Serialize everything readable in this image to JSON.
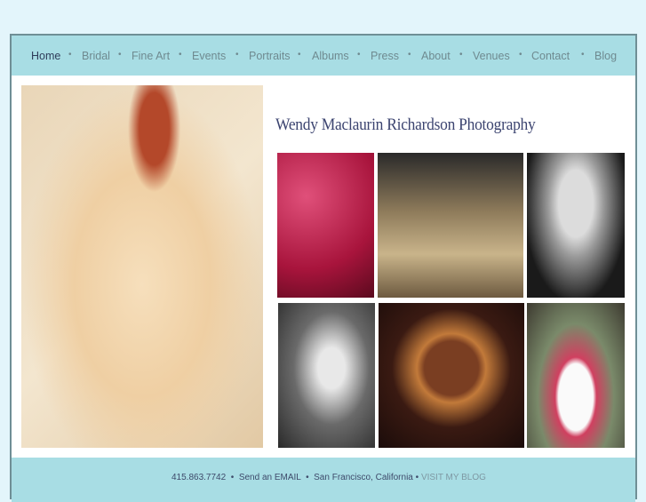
{
  "nav": {
    "items": [
      {
        "label": "Home",
        "active": true
      },
      {
        "label": "Bridal"
      },
      {
        "label": "Fine Art"
      },
      {
        "label": "Events"
      },
      {
        "label": "Portraits"
      },
      {
        "label": "Albums"
      },
      {
        "label": "Press"
      },
      {
        "label": "About"
      },
      {
        "label": "Venues"
      },
      {
        "label": "Contact"
      },
      {
        "label": "Blog"
      }
    ],
    "separator": "•"
  },
  "site_title": "Wendy Maclaurin Richardson Photography",
  "footer": {
    "phone": "415.863.7742",
    "email_link": "Send an EMAIL",
    "location": "San Francisco, California",
    "blog_link": "VISIT MY BLOG",
    "sep": "•"
  },
  "colors": {
    "nav_bg": "#a8dde4",
    "page_bg": "#e3f5fb",
    "title": "#3c4470"
  }
}
